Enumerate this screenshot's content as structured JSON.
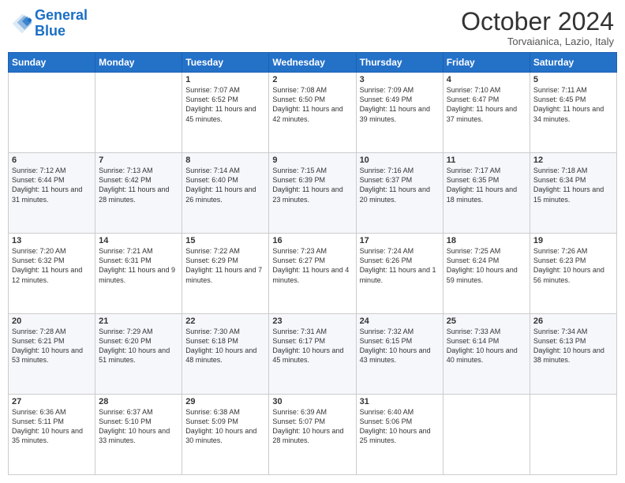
{
  "header": {
    "logo_line1": "General",
    "logo_line2": "Blue",
    "title": "October 2024",
    "subtitle": "Torvaianica, Lazio, Italy"
  },
  "weekdays": [
    "Sunday",
    "Monday",
    "Tuesday",
    "Wednesday",
    "Thursday",
    "Friday",
    "Saturday"
  ],
  "weeks": [
    [
      {
        "day": "",
        "info": ""
      },
      {
        "day": "",
        "info": ""
      },
      {
        "day": "1",
        "info": "Sunrise: 7:07 AM\nSunset: 6:52 PM\nDaylight: 11 hours and 45 minutes."
      },
      {
        "day": "2",
        "info": "Sunrise: 7:08 AM\nSunset: 6:50 PM\nDaylight: 11 hours and 42 minutes."
      },
      {
        "day": "3",
        "info": "Sunrise: 7:09 AM\nSunset: 6:49 PM\nDaylight: 11 hours and 39 minutes."
      },
      {
        "day": "4",
        "info": "Sunrise: 7:10 AM\nSunset: 6:47 PM\nDaylight: 11 hours and 37 minutes."
      },
      {
        "day": "5",
        "info": "Sunrise: 7:11 AM\nSunset: 6:45 PM\nDaylight: 11 hours and 34 minutes."
      }
    ],
    [
      {
        "day": "6",
        "info": "Sunrise: 7:12 AM\nSunset: 6:44 PM\nDaylight: 11 hours and 31 minutes."
      },
      {
        "day": "7",
        "info": "Sunrise: 7:13 AM\nSunset: 6:42 PM\nDaylight: 11 hours and 28 minutes."
      },
      {
        "day": "8",
        "info": "Sunrise: 7:14 AM\nSunset: 6:40 PM\nDaylight: 11 hours and 26 minutes."
      },
      {
        "day": "9",
        "info": "Sunrise: 7:15 AM\nSunset: 6:39 PM\nDaylight: 11 hours and 23 minutes."
      },
      {
        "day": "10",
        "info": "Sunrise: 7:16 AM\nSunset: 6:37 PM\nDaylight: 11 hours and 20 minutes."
      },
      {
        "day": "11",
        "info": "Sunrise: 7:17 AM\nSunset: 6:35 PM\nDaylight: 11 hours and 18 minutes."
      },
      {
        "day": "12",
        "info": "Sunrise: 7:18 AM\nSunset: 6:34 PM\nDaylight: 11 hours and 15 minutes."
      }
    ],
    [
      {
        "day": "13",
        "info": "Sunrise: 7:20 AM\nSunset: 6:32 PM\nDaylight: 11 hours and 12 minutes."
      },
      {
        "day": "14",
        "info": "Sunrise: 7:21 AM\nSunset: 6:31 PM\nDaylight: 11 hours and 9 minutes."
      },
      {
        "day": "15",
        "info": "Sunrise: 7:22 AM\nSunset: 6:29 PM\nDaylight: 11 hours and 7 minutes."
      },
      {
        "day": "16",
        "info": "Sunrise: 7:23 AM\nSunset: 6:27 PM\nDaylight: 11 hours and 4 minutes."
      },
      {
        "day": "17",
        "info": "Sunrise: 7:24 AM\nSunset: 6:26 PM\nDaylight: 11 hours and 1 minute."
      },
      {
        "day": "18",
        "info": "Sunrise: 7:25 AM\nSunset: 6:24 PM\nDaylight: 10 hours and 59 minutes."
      },
      {
        "day": "19",
        "info": "Sunrise: 7:26 AM\nSunset: 6:23 PM\nDaylight: 10 hours and 56 minutes."
      }
    ],
    [
      {
        "day": "20",
        "info": "Sunrise: 7:28 AM\nSunset: 6:21 PM\nDaylight: 10 hours and 53 minutes."
      },
      {
        "day": "21",
        "info": "Sunrise: 7:29 AM\nSunset: 6:20 PM\nDaylight: 10 hours and 51 minutes."
      },
      {
        "day": "22",
        "info": "Sunrise: 7:30 AM\nSunset: 6:18 PM\nDaylight: 10 hours and 48 minutes."
      },
      {
        "day": "23",
        "info": "Sunrise: 7:31 AM\nSunset: 6:17 PM\nDaylight: 10 hours and 45 minutes."
      },
      {
        "day": "24",
        "info": "Sunrise: 7:32 AM\nSunset: 6:15 PM\nDaylight: 10 hours and 43 minutes."
      },
      {
        "day": "25",
        "info": "Sunrise: 7:33 AM\nSunset: 6:14 PM\nDaylight: 10 hours and 40 minutes."
      },
      {
        "day": "26",
        "info": "Sunrise: 7:34 AM\nSunset: 6:13 PM\nDaylight: 10 hours and 38 minutes."
      }
    ],
    [
      {
        "day": "27",
        "info": "Sunrise: 6:36 AM\nSunset: 5:11 PM\nDaylight: 10 hours and 35 minutes."
      },
      {
        "day": "28",
        "info": "Sunrise: 6:37 AM\nSunset: 5:10 PM\nDaylight: 10 hours and 33 minutes."
      },
      {
        "day": "29",
        "info": "Sunrise: 6:38 AM\nSunset: 5:09 PM\nDaylight: 10 hours and 30 minutes."
      },
      {
        "day": "30",
        "info": "Sunrise: 6:39 AM\nSunset: 5:07 PM\nDaylight: 10 hours and 28 minutes."
      },
      {
        "day": "31",
        "info": "Sunrise: 6:40 AM\nSunset: 5:06 PM\nDaylight: 10 hours and 25 minutes."
      },
      {
        "day": "",
        "info": ""
      },
      {
        "day": "",
        "info": ""
      }
    ]
  ]
}
